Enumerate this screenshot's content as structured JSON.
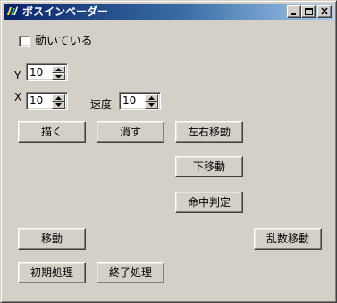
{
  "window": {
    "title": "ボスインベーダー",
    "minimize_icon": "minimize-icon",
    "maximize_icon": "maximize-icon",
    "close_icon": "close-icon"
  },
  "checkbox": {
    "label": "動いている",
    "checked": false
  },
  "fields": {
    "y_label": "Y",
    "y_value": "10",
    "x_label": "X",
    "x_value": "10",
    "speed_label": "速度",
    "speed_value": "10"
  },
  "buttons": {
    "draw": "描く",
    "erase": "消す",
    "move_lr": "左右移動",
    "move_down": "下移動",
    "hit_test": "命中判定",
    "move": "移動",
    "random_move": "乱数移動",
    "init": "初期処理",
    "finish": "終了処理"
  },
  "colors": {
    "face": "#d4d0c8",
    "title_start": "#0a246a",
    "title_end": "#a6caf0"
  }
}
